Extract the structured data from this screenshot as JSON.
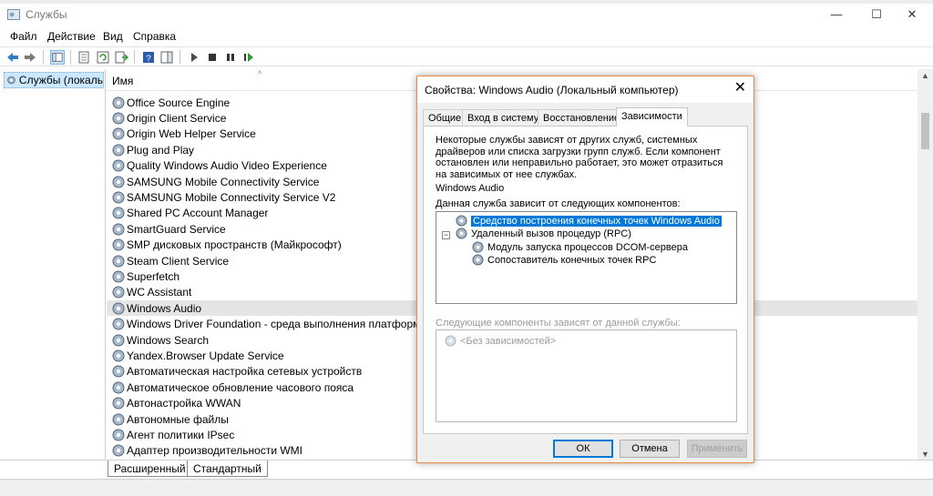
{
  "window": {
    "title": "Службы",
    "min": "—",
    "max": "☐",
    "close": "✕"
  },
  "menu": [
    "Файл",
    "Действие",
    "Вид",
    "Справка"
  ],
  "tree": {
    "root": "Службы (локальные)"
  },
  "list": {
    "column_name": "Имя",
    "services": [
      "Office  Source Engine",
      "Origin Client Service",
      "Origin Web Helper Service",
      "Plug and Play",
      "Quality Windows Audio Video Experience",
      "SAMSUNG Mobile Connectivity Service",
      "SAMSUNG Mobile Connectivity Service V2",
      "Shared PC Account Manager",
      "SmartGuard Service",
      "SMP дисковых пространств (Майкрософт)",
      "Steam Client Service",
      "Superfetch",
      "WC Assistant",
      "Windows Audio",
      "Windows Driver Foundation - среда выполнения платформы ...",
      "Windows Search",
      "Yandex.Browser Update Service",
      "Автоматическая настройка сетевых устройств",
      "Автоматическое обновление часового пояса",
      "Автонастройка WWAN",
      "Автономные файлы",
      "Агент политики IPsec",
      "Адаптер производительности WMI"
    ],
    "selected_index": 13
  },
  "bottom_tabs": {
    "extended": "Расширенный",
    "standard": "Стандартный"
  },
  "dialog": {
    "title": "Свойства: Windows Audio (Локальный компьютер)",
    "tabs": [
      "Общие",
      "Вход в систему",
      "Восстановление",
      "Зависимости"
    ],
    "active_tab": "Зависимости",
    "description": "Некоторые службы зависят от других служб, системных драйверов или списка загрузки групп служб. Если компонент остановлен или неправильно работает, это может отразиться на зависимых от нее службах.",
    "service_name": "Windows Audio",
    "depends_on_label": "Данная служба зависит от следующих компонентов:",
    "depends_on": {
      "item1": "Средство построения конечных точек Windows Audio",
      "item2": "Удаленный вызов процедур (RPC)",
      "item2_child1": "Модуль запуска процессов DCOM-сервера",
      "item2_child2": "Сопоставитель конечных точек RPC"
    },
    "dependents_label": "Следующие компоненты зависят от данной службы:",
    "dependents_none": "<Без зависимостей>",
    "buttons": {
      "ok": "ОК",
      "cancel": "Отмена",
      "apply": "Применить"
    }
  },
  "colors": {
    "selection": "#0078d7",
    "dialog_border": "#e88a4a",
    "tree_selection": "#cce8ff"
  }
}
